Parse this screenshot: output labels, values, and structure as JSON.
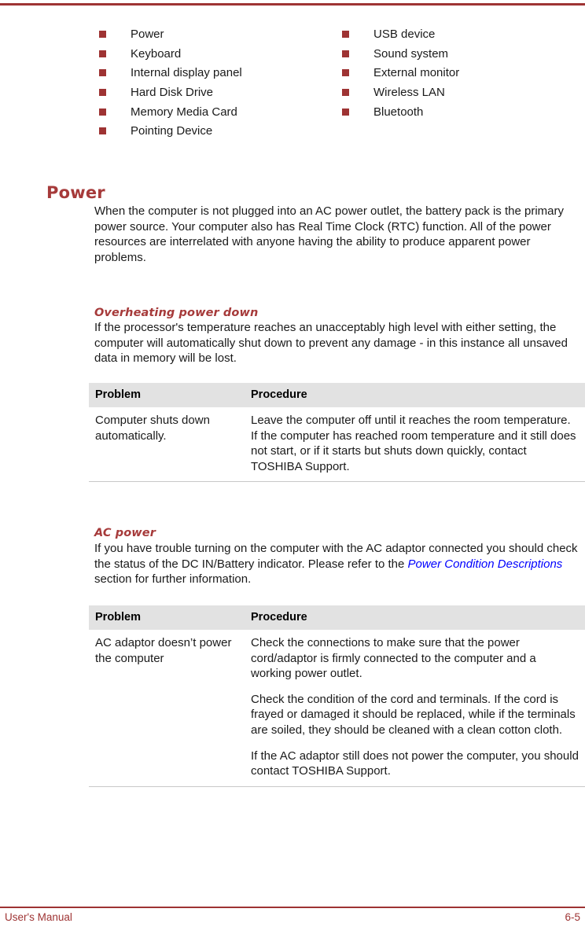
{
  "page": {
    "footer_left": "User's Manual",
    "footer_right": "6-5",
    "rule_color": "#9e3333",
    "heading_color": "#a63a3a",
    "bullet_color": "#9e3333",
    "link_color": "#0000ff",
    "table_header_bg": "#e2e2e2"
  },
  "bullet_list": {
    "left_column": [
      {
        "label": "Power"
      },
      {
        "label": "Keyboard"
      },
      {
        "label": "Internal display panel"
      },
      {
        "label": "Hard Disk Drive"
      },
      {
        "label": "Memory Media Card"
      },
      {
        "label": "Pointing Device"
      }
    ],
    "right_column": [
      {
        "label": "USB device"
      },
      {
        "label": "Sound system"
      },
      {
        "label": "External monitor"
      },
      {
        "label": "Wireless LAN"
      },
      {
        "label": "Bluetooth"
      }
    ]
  },
  "sections": {
    "power": {
      "heading": "Power",
      "intro": "When the computer is not plugged into an AC power outlet, the battery pack is the primary power source. Your computer also has Real Time Clock (RTC) function. All of the power resources are interrelated with anyone having the ability to produce apparent power problems."
    },
    "overheating": {
      "heading": "Overheating power down",
      "intro": "If the processor's temperature reaches an unacceptably high level with either setting, the computer will automatically shut down to prevent any damage - in this instance all unsaved data in memory will be lost.",
      "table": {
        "columns": [
          "Problem",
          "Procedure"
        ],
        "rows": [
          {
            "problem": "Computer shuts down automatically.",
            "procedure": [
              "Leave the computer off until it reaches the room temperature. If the computer has reached room temperature and it still does not start, or if it starts but shuts down quickly, contact TOSHIBA Support."
            ]
          }
        ]
      }
    },
    "ac_power": {
      "heading": "AC power",
      "intro_before_link": "If you have trouble turning on the computer with the AC adaptor connected you should check the status of the DC IN/Battery indicator. Please refer to the ",
      "link_text": "Power Condition Descriptions",
      "intro_after_link": " section for further information.",
      "table": {
        "columns": [
          "Problem",
          "Procedure"
        ],
        "rows": [
          {
            "problem": "AC adaptor doesn’t power the computer",
            "procedure": [
              "Check the connections to make sure that the power cord/adaptor is firmly connected to the computer and a working power outlet.",
              "Check the condition of the cord and terminals. If the cord is frayed or damaged it should be replaced, while if the terminals are soiled, they should be cleaned with a clean cotton cloth.",
              "If the AC adaptor still does not power the computer, you should contact TOSHIBA Support."
            ]
          }
        ]
      }
    }
  }
}
